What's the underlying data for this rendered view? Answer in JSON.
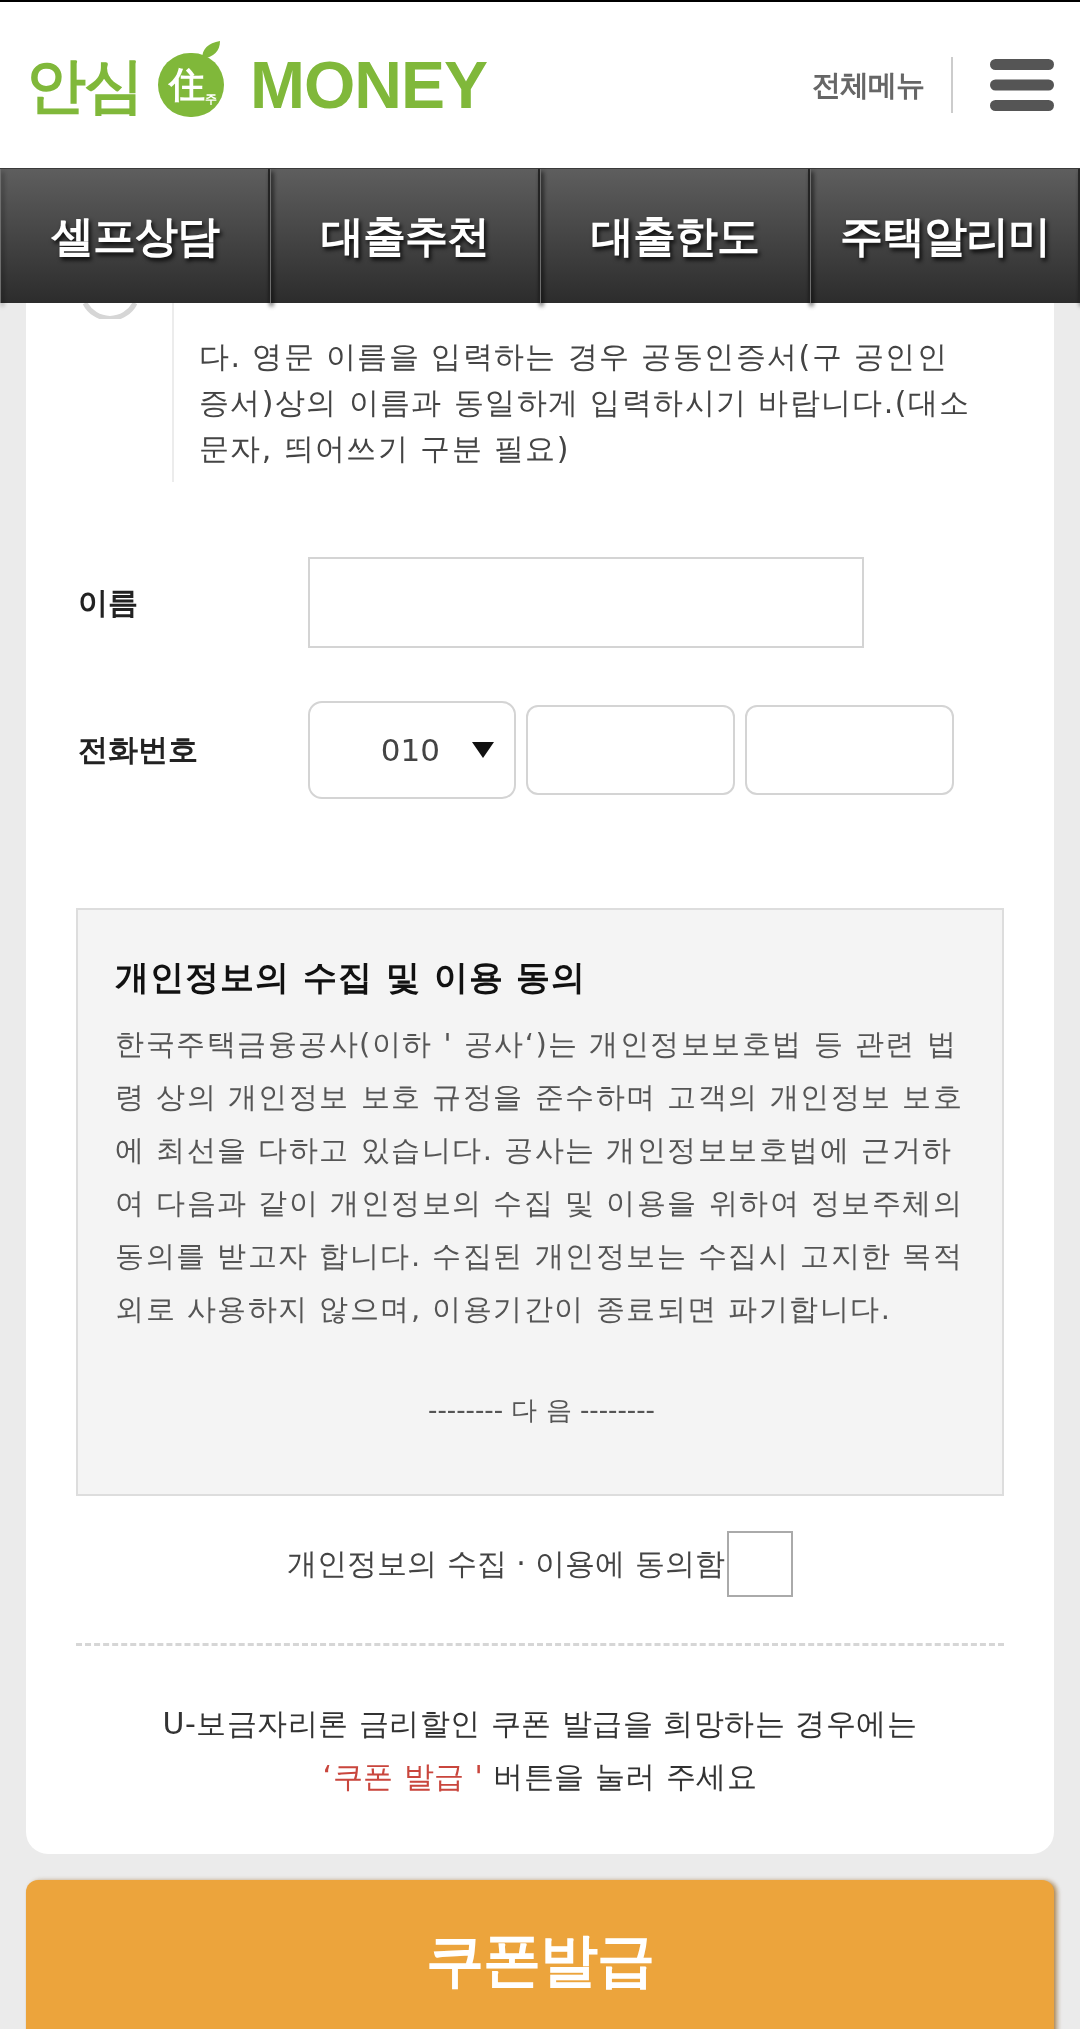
{
  "header": {
    "logo": {
      "left_text": "안심",
      "emblem_character": "住",
      "emblem_caption": "주",
      "right_text": "MONEY"
    },
    "menu_label": "전체메뉴"
  },
  "nav": {
    "tabs": [
      {
        "label": "셀프상담"
      },
      {
        "label": "대출추천"
      },
      {
        "label": "대출한도"
      },
      {
        "label": "주택알리미"
      }
    ]
  },
  "notice": {
    "text": "다. 영문 이름을 입력하는 경우 공동인증서(구 공인인증서)상의 이름과 동일하게 입력하시기 바랍니다.(대소문자, 띄어쓰기 구분 필요)"
  },
  "form": {
    "fields": [
      {
        "kind": "text",
        "label": "이름"
      },
      {
        "kind": "phone",
        "label": "전화번호",
        "prefix": "010"
      }
    ]
  },
  "consent": {
    "title": "개인정보의 수집 및 이용 동의",
    "body": "한국주택금융공사(이하 ' 공사‘)는 개인정보보호법 등 관련 법령 상의 개인정보 보호 규정을 준수하며 고객의 개인정보 보호에 최선을 다하고 있습니다. 공사는 개인정보보호법에 근거하여 다음과 같이 개인정보의 수집 및 이용을 위하여 정보주체의 동의를 받고자 합니다. 수집된 개인정보는 수집시 고지한 목적 외로 사용하지 않으며, 이용기간이 종료되면 파기합니다.",
    "separator": "-------- 다 음 --------"
  },
  "agreement": {
    "label": "개인정보의 수집 · 이용에 동의함",
    "checked": false
  },
  "coupon_notice": {
    "text": "U-보금자리론 금리할인 쿠폰 발급을 희망하는 경우에는",
    "highlight": "‘쿠폰 발급 '",
    "text_after": "버튼을 눌러 주세요"
  },
  "submit_button": {
    "label": "쿠폰발급"
  }
}
